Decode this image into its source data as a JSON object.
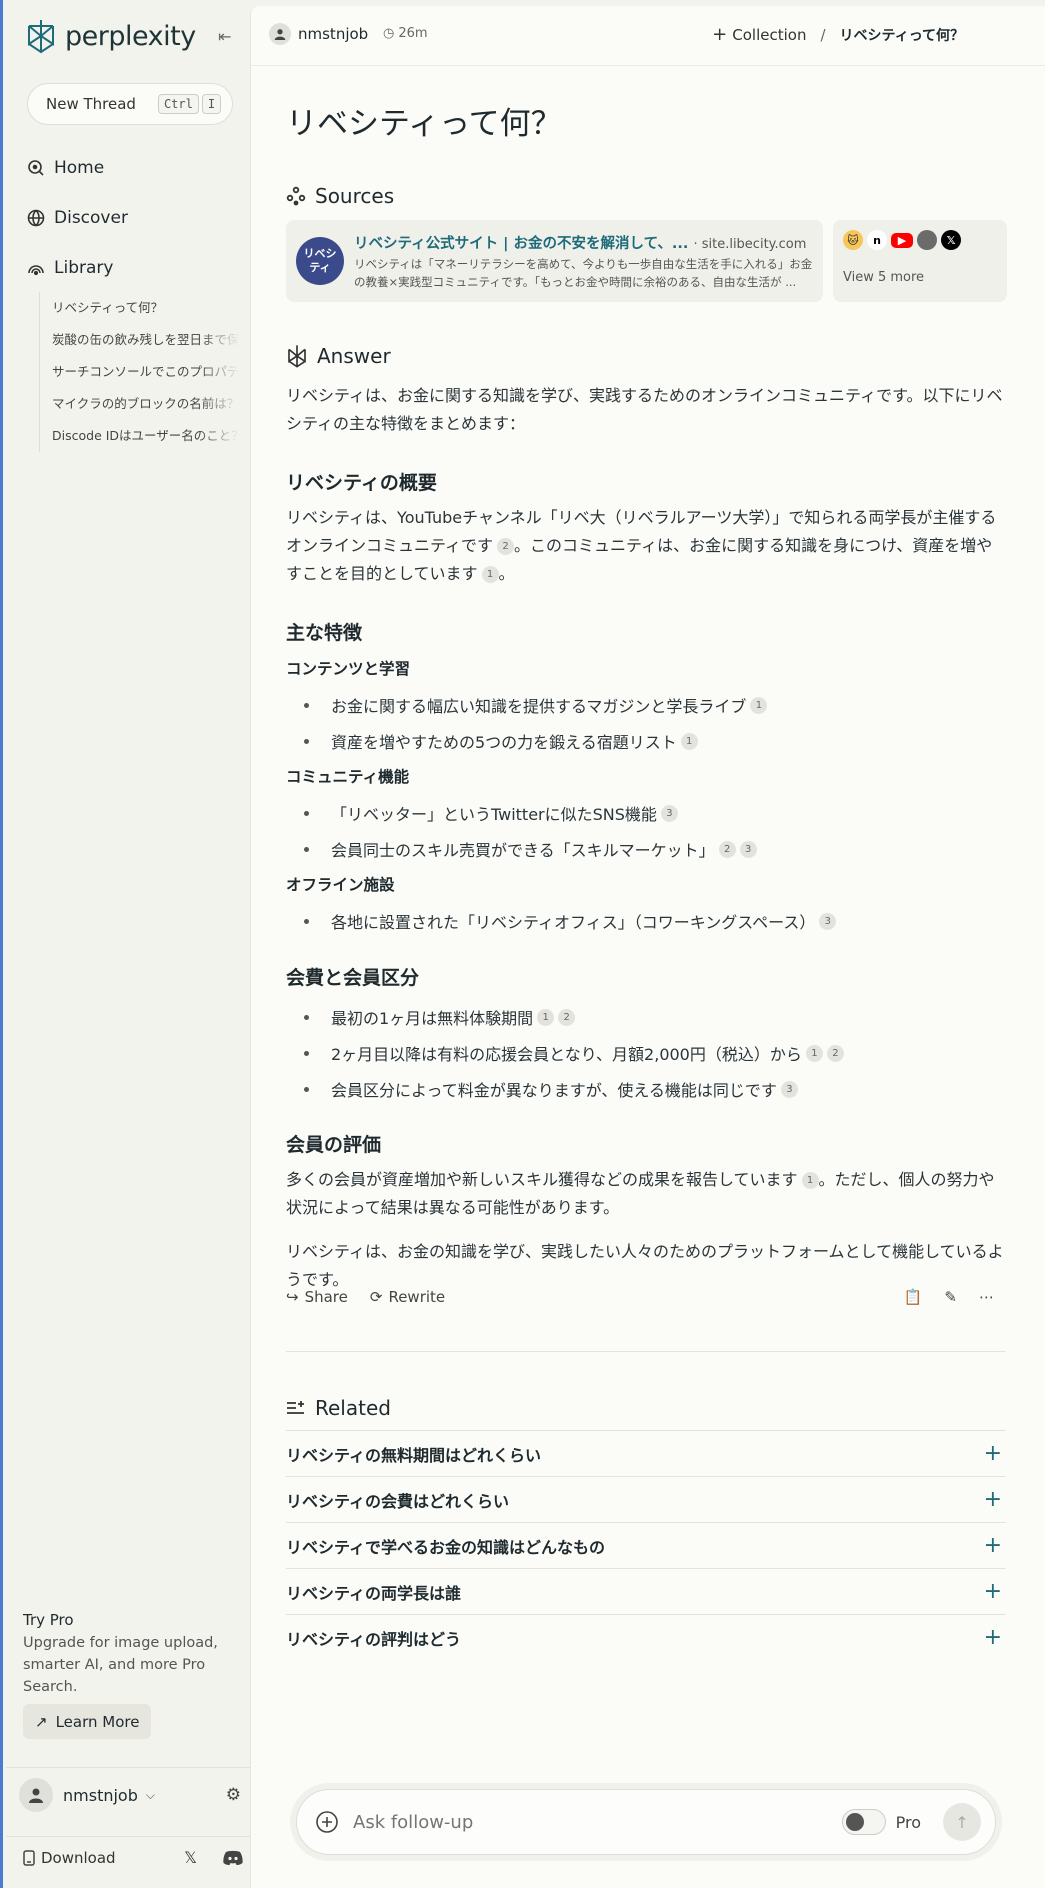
{
  "sidebar": {
    "logo_text": "perplexity",
    "new_thread_label": "New Thread",
    "shortcut_ctrl": "Ctrl",
    "shortcut_key": "I",
    "nav": {
      "home": "Home",
      "discover": "Discover",
      "library": "Library"
    },
    "library_items": [
      "リベシティって何？",
      "炭酸の缶の飲み残しを翌日まで保",
      "サーチコンソールでこのプロパティへの",
      "マイクラの的ブロックの名前は？",
      "Discode IDはユーザー名のこと？"
    ],
    "try_pro": {
      "title": "Try Pro",
      "desc": "Upgrade for image upload, smarter AI, and more Pro Search.",
      "learn_more": "Learn More"
    },
    "user_name": "nmstnjob",
    "download_label": "Download"
  },
  "topbar": {
    "user": "nmstnjob",
    "time": "26m",
    "collection_label": "Collection",
    "separator": "/",
    "thread_title": "リベシティって何？"
  },
  "main": {
    "title": "リベシティって何？",
    "sources_label": "Sources",
    "source_card": {
      "thumb_text": "リベシティ",
      "title": "リベシティ公式サイト | お金の不安を解消して、...",
      "domain": "· site.libecity.com",
      "desc": "リベシティは「マネーリテラシーを高めて、今よりも一歩自由な生活を手に入れる」お金の教養×実践型コミュニティです。「もっとお金や時間に余裕のある、自由な生活が ..."
    },
    "more_label": "View 5 more",
    "answer_label": "Answer",
    "intro": "リベシティは、お金に関する知識を学び、実践するためのオンラインコミュニティです。以下にリベシティの主な特徴をまとめます：",
    "overview_heading": "リベシティの概要",
    "overview_p1": "リベシティは、YouTubeチャンネル「リベ大（リベラルアーツ大学）」で知られる両学長が主催するオンラインコミュニティです",
    "overview_p2": "。このコミュニティは、お金に関する知識を身につけ、資産を増やすことを目的としています",
    "overview_p3": "。",
    "features_heading": "主な特徴",
    "content_heading": "コンテンツと学習",
    "content_items": [
      {
        "text": "お金に関する幅広い知識を提供するマガジンと学長ライブ",
        "cites": [
          "1"
        ]
      },
      {
        "text": "資産を増やすための5つの力を鍛える宿題リスト",
        "cites": [
          "1"
        ]
      }
    ],
    "community_heading": "コミュニティ機能",
    "community_items": [
      {
        "text": "「リベッター」というTwitterに似たSNS機能",
        "cites": [
          "3"
        ]
      },
      {
        "text": "会員同士のスキル売買ができる「スキルマーケット」",
        "cites": [
          "2",
          "3"
        ]
      }
    ],
    "offline_heading": "オフライン施設",
    "offline_items": [
      {
        "text": "各地に設置された「リベシティオフィス」（コワーキングスペース）",
        "cites": [
          "3"
        ]
      }
    ],
    "fees_heading": "会費と会員区分",
    "fees_items": [
      {
        "text": "最初の1ヶ月は無料体験期間",
        "cites": [
          "1",
          "2"
        ]
      },
      {
        "text": "2ヶ月目以降は有料の応援会員となり、月額2,000円（税込）から",
        "cites": [
          "1",
          "2"
        ]
      },
      {
        "text": "会員区分によって料金が異なりますが、使える機能は同じです",
        "cites": [
          "3"
        ]
      }
    ],
    "eval_heading": "会員の評価",
    "eval_p1": "多くの会員が資産増加や新しいスキル獲得などの成果を報告しています",
    "eval_p2": "。ただし、個人の努力や状況によって結果は異なる可能性があります。",
    "closing": "リベシティは、お金の知識を学び、実践したい人々のためのプラットフォームとして機能しているようです。",
    "share_label": "Share",
    "rewrite_label": "Rewrite",
    "related_label": "Related",
    "related_items": [
      "リベシティの無料期間はどれくらい",
      "リベシティの会費はどれくらい",
      "リベシティで学べるお金の知識はどんなもの",
      "リベシティの両学長は誰",
      "リベシティの評判はどう"
    ],
    "ask_placeholder": "Ask follow-up",
    "pro_label": "Pro"
  }
}
